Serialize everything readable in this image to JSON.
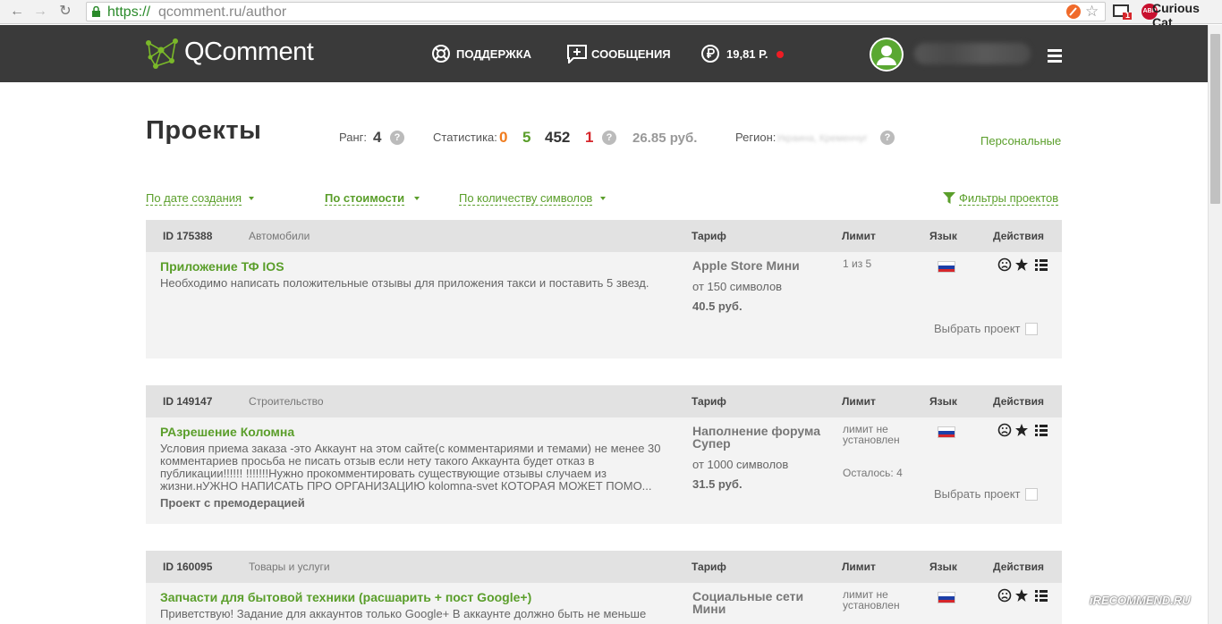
{
  "browser": {
    "url_scheme": "https://",
    "url_host_path": "qcomment.ru/author",
    "extension_label": "Curious Cat",
    "badge_count": "1",
    "badge_abp": "ABP"
  },
  "header": {
    "logo": "QComment",
    "support": "ПОДДЕРЖКА",
    "messages": "СООБЩЕНИЯ",
    "balance": "19,81 Р."
  },
  "page": {
    "title": "Проекты",
    "rank_label": "Ранг:",
    "rank_value": "4",
    "stats_label": "Статистика:",
    "stat_orange": "0",
    "stat_green": "5",
    "stat_dark": "452",
    "stat_red": "1",
    "earned": "26.85 руб.",
    "region_label": "Регион:",
    "region_value": "Украина, Кременчуг",
    "personal_link": "Персональные"
  },
  "sorting": {
    "by_date": "По дате создания",
    "by_price": "По стоимости",
    "by_chars": "По количеству символов",
    "filters": "Фильтры проектов"
  },
  "columns": {
    "tariff": "Тариф",
    "limit": "Лимит",
    "lang": "Язык",
    "actions": "Действия"
  },
  "pick_label": "Выбрать проект",
  "projects": [
    {
      "id": "ID 175388",
      "category": "Автомобили",
      "title": "Приложение ТФ IOS",
      "desc": "Необходимо написать положительные отзывы для приложения такси и поставить 5 звезд.",
      "premod": "",
      "tariff": "Apple Store Мини",
      "symbols": "от 150 символов",
      "price": "40.5 руб.",
      "limit": "1 из 5",
      "remaining": ""
    },
    {
      "id": "ID 149147",
      "category": "Строительство",
      "title": "РАзрешение Коломна",
      "desc": "Условия приема заказа -это Аккаунт на этом сайте(с комментариями и темами) не менее 30 комментариев просьба не писать отзыв если нету такого Аккаунта будет отказ в публикации!!!!!! !!!!!!!Нужно прокомментировать существующие отзывы случаем из жизни.нУЖНО НАПИСАТЬ ПРО ОРГАНИЗАЦИЮ kolomna-svet КОТОРАЯ МОЖЕТ ПОМО...",
      "premod": "Проект с премодерацией",
      "tariff": "Наполнение форума Супер",
      "symbols": "от 1000 символов",
      "price": "31.5 руб.",
      "limit": "лимит не установлен",
      "remaining": "Осталось: 4"
    },
    {
      "id": "ID 160095",
      "category": "Товары и услуги",
      "title": "Запчасти для бытовой техники (расшарить + пост Google+)",
      "desc": "Приветствую! Задание для аккаунтов только Google+ В аккаунте должно быть не меньше",
      "premod": "",
      "tariff": "Социальные сети Мини",
      "symbols": "",
      "price": "",
      "limit": "лимит не установлен",
      "remaining": ""
    }
  ],
  "watermark": "iRECOMMEND.RU",
  "colors": {
    "accent_green": "#5a9e2a",
    "header_bg": "#3a3a3a",
    "stat_orange": "#f07c1e",
    "stat_green": "#5a9e2a",
    "stat_red": "#d6262b"
  }
}
